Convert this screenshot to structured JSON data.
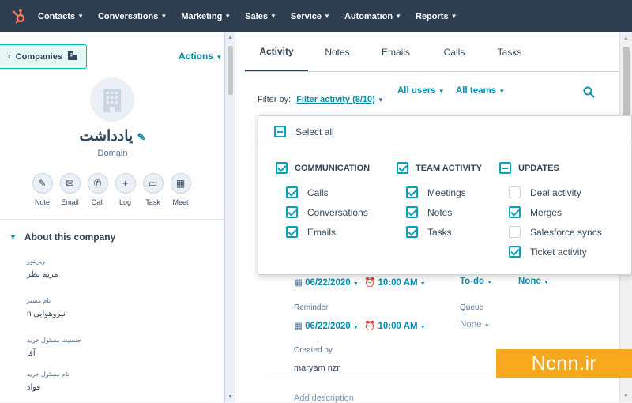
{
  "nav": {
    "items": [
      "Contacts",
      "Conversations",
      "Marketing",
      "Sales",
      "Service",
      "Automation",
      "Reports"
    ]
  },
  "left": {
    "back_label": "Companies",
    "actions_label": "Actions",
    "company_name": "یادداشت",
    "domain_label": "Domain",
    "action_buttons": [
      "Note",
      "Email",
      "Call",
      "Log",
      "Task",
      "Meet"
    ],
    "about_title": "About this company",
    "properties": [
      {
        "label": "ویزیتور",
        "value": "مریم نظر"
      },
      {
        "label": "نام مسیر",
        "value": "n نیروهوایی"
      },
      {
        "label": "جنسیت مسئول خرید",
        "value": "آقا"
      },
      {
        "label": "نام مسئول خرید",
        "value": "فواد"
      }
    ]
  },
  "main": {
    "tabs": [
      "Activity",
      "Notes",
      "Emails",
      "Calls",
      "Tasks"
    ],
    "filter_label": "Filter by:",
    "filter_link": "Filter activity (8/10)",
    "users_select": "All users",
    "teams_select": "All teams"
  },
  "filter_dropdown": {
    "select_all": "Select all",
    "groups": [
      {
        "title": "COMMUNICATION",
        "state": "on",
        "items": [
          {
            "label": "Calls",
            "checked": true
          },
          {
            "label": "Conversations",
            "checked": true
          },
          {
            "label": "Emails",
            "checked": true
          }
        ]
      },
      {
        "title": "TEAM ACTIVITY",
        "state": "on",
        "items": [
          {
            "label": "Meetings",
            "checked": true
          },
          {
            "label": "Notes",
            "checked": true
          },
          {
            "label": "Tasks",
            "checked": true
          }
        ]
      },
      {
        "title": "UPDATES",
        "state": "ind",
        "items": [
          {
            "label": "Deal activity",
            "checked": false
          },
          {
            "label": "Merges",
            "checked": true
          },
          {
            "label": "Salesforce syncs",
            "checked": false
          },
          {
            "label": "Ticket activity",
            "checked": true
          }
        ]
      }
    ]
  },
  "task": {
    "due_date": "06/22/2020",
    "due_time": "10:00 AM",
    "type": "To-do",
    "priority": "None",
    "reminder_label": "Reminder",
    "queue_label": "Queue",
    "reminder_date": "06/22/2020",
    "reminder_time": "10:00 AM",
    "queue_value": "None",
    "created_by_label": "Created by",
    "created_by_value": "maryam nzr",
    "description_placeholder": "Add description"
  },
  "watermark": "Ncnn.ir",
  "colors": {
    "nav_bg": "#2d3e50",
    "accent": "#0091ae",
    "checkbox": "#00a4bd",
    "logo": "#ff7a59",
    "watermark": "#f7a81c"
  }
}
